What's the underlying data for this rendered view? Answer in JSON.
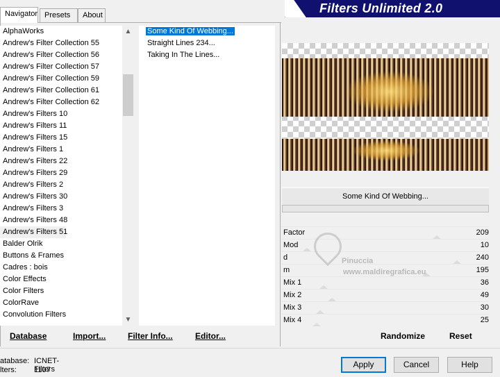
{
  "tabs": [
    {
      "label": "Navigator",
      "active": true
    },
    {
      "label": "Presets",
      "active": false
    },
    {
      "label": "About",
      "active": false
    }
  ],
  "banner": {
    "title": "Filters Unlimited 2.0"
  },
  "categories": [
    "AlphaWorks",
    "Andrew's Filter Collection 55",
    "Andrew's Filter Collection 56",
    "Andrew's Filter Collection 57",
    "Andrew's Filter Collection 59",
    "Andrew's Filter Collection 61",
    "Andrew's Filter Collection 62",
    "Andrew's Filters 10",
    "Andrew's Filters 11",
    "Andrew's Filters 15",
    "Andrew's Filters 1",
    "Andrew's Filters 22",
    "Andrew's Filters 29",
    "Andrew's Filters 2",
    "Andrew's Filters 30",
    "Andrew's Filters 3",
    "Andrew's Filters 48",
    "Andrew's Filters 51",
    "Balder Olrik",
    "Buttons & Frames",
    "Cadres : bois",
    "Color Effects",
    "Color Filters",
    "ColorRave",
    "Convolution Filters"
  ],
  "selected_category": "Andrew's Filters 51",
  "filters": [
    "Some Kind Of Webbing...",
    "Straight Lines 234...",
    "Taking In The Lines..."
  ],
  "selected_filter": "Some Kind Of Webbing...",
  "bottom_buttons": {
    "database": "Database",
    "import": "Import...",
    "filter_info": "Filter Info...",
    "editor": "Editor..."
  },
  "current_filter_name": "Some Kind Of Webbing...",
  "params": [
    {
      "label": "Factor",
      "value": "209",
      "level": 0.82
    },
    {
      "label": "Mod",
      "value": "10",
      "level": 0.04
    },
    {
      "label": "d",
      "value": "240",
      "level": 0.94
    },
    {
      "label": "m",
      "value": "195",
      "level": 0.76
    },
    {
      "label": "Mix 1",
      "value": "36",
      "level": 0.14
    },
    {
      "label": "Mix 2",
      "value": "49",
      "level": 0.19
    },
    {
      "label": "Mix 3",
      "value": "30",
      "level": 0.12
    },
    {
      "label": "Mix 4",
      "value": "25",
      "level": 0.1
    }
  ],
  "actions": {
    "randomize": "Randomize",
    "reset": "Reset"
  },
  "info": {
    "database_label": "atabase:",
    "database_value": "ICNET-Filters",
    "filters_label": "lters:",
    "filters_value": "1107"
  },
  "dialog_buttons": {
    "apply": "Apply",
    "cancel": "Cancel",
    "help": "Help"
  },
  "watermark": {
    "line1": "Pinuccia",
    "line2": "www.maldiregrafica.eu"
  },
  "colors": {
    "selection": "#0078d7",
    "banner": "#10106e"
  }
}
